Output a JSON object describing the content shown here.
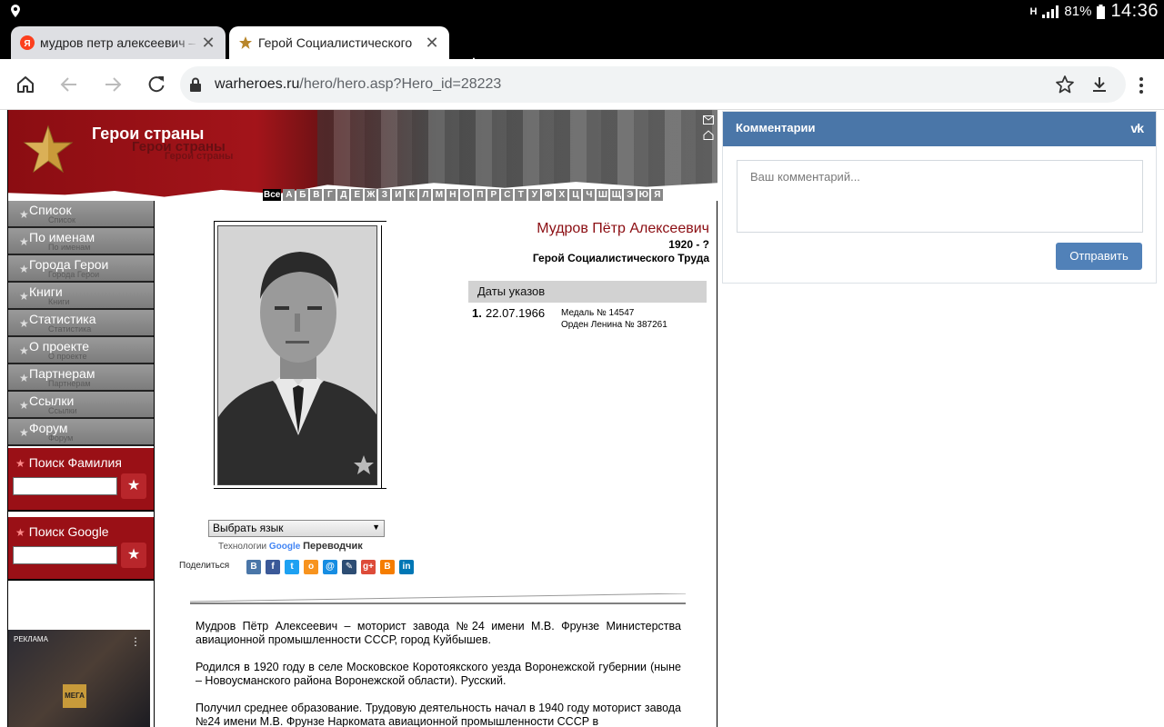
{
  "statusbar": {
    "network": "H",
    "battery": "81%",
    "time": "14:36"
  },
  "tabs": [
    {
      "title": "мудров петр алексеевич – ",
      "favicon": "yandex-icon",
      "active": false
    },
    {
      "title": "Герой Социалистического ",
      "favicon": "star-icon",
      "active": true
    }
  ],
  "toolbar": {
    "url_host": "warheroes.ru",
    "url_path": "/hero/hero.asp?Hero_id=28223"
  },
  "site": {
    "banner_title": "Герои страны",
    "banner_title_echo1": "Герои страны",
    "banner_title_echo2": "Герои страны",
    "alphabet": [
      "Все",
      "А",
      "Б",
      "В",
      "Г",
      "Д",
      "Е",
      "Ж",
      "З",
      "И",
      "К",
      "Л",
      "М",
      "Н",
      "О",
      "П",
      "Р",
      "С",
      "Т",
      "У",
      "Ф",
      "Х",
      "Ц",
      "Ч",
      "Ш",
      "Щ",
      "Э",
      "Ю",
      "Я"
    ],
    "nav": [
      {
        "label": "Список",
        "shadow": "Список"
      },
      {
        "label": "По именам",
        "shadow": "По именам"
      },
      {
        "label": "Города Герои",
        "shadow": "Города Герои"
      },
      {
        "label": "Книги",
        "shadow": "Книги"
      },
      {
        "label": "Статистика",
        "shadow": "Статистика"
      },
      {
        "label": "О проекте",
        "shadow": "О проекте"
      },
      {
        "label": "Партнерам",
        "shadow": "Партнерам"
      },
      {
        "label": "Ссылки",
        "shadow": "Ссылки"
      },
      {
        "label": "Форум",
        "shadow": "Форум"
      }
    ],
    "search_surname": "Поиск Фамилия",
    "search_google": "Поиск Google",
    "ad_label": "РЕКЛАМА",
    "ad_sign": "МЕГА"
  },
  "hero": {
    "name": "Мудров Пётр Алексеевич",
    "years": "1920 - ?",
    "title": "Герой Социалистического Труда",
    "decrees_header": "Даты указов",
    "decrees": [
      {
        "num": "1.",
        "date": "22.07.1966",
        "awards": [
          "Медаль № 14547",
          "Орден Ленина № 387261"
        ]
      }
    ]
  },
  "translate": {
    "select_label": "Выбрать язык",
    "powered_prefix": "Технологии",
    "google": "Google",
    "translator": "Переводчик"
  },
  "share": {
    "label": "Поделиться",
    "icons": [
      {
        "name": "vkontakte-icon",
        "glyph": "В",
        "color": "#4a76a8"
      },
      {
        "name": "facebook-icon",
        "glyph": "f",
        "color": "#3b5998"
      },
      {
        "name": "twitter-icon",
        "glyph": "t",
        "color": "#1da1f2"
      },
      {
        "name": "odnoklassniki-icon",
        "glyph": "о",
        "color": "#f7931e"
      },
      {
        "name": "mailru-icon",
        "glyph": "@",
        "color": "#168de2"
      },
      {
        "name": "livejournal-icon",
        "glyph": "✎",
        "color": "#2d4d73"
      },
      {
        "name": "googleplus-icon",
        "glyph": "g+",
        "color": "#dd4b39"
      },
      {
        "name": "blogger-icon",
        "glyph": "B",
        "color": "#f57d00"
      },
      {
        "name": "linkedin-icon",
        "glyph": "in",
        "color": "#0077b5"
      }
    ]
  },
  "bio": [
    "Мудров Пётр Алексеевич – моторист завода №24 имени М.В. Фрунзе Министерства авиационной промышленности СССР, город Куйбышев.",
    "Родился в 1920 году в селе Московское Коротоякского уезда Воронежской губернии (ныне – Новоусманского района Воронежской области). Русский.",
    "Получил среднее образование. Трудовую деятельность начал в 1940 году моторист завода №24 имени М.В. Фрунзе Наркомата авиационной промышленности СССР в"
  ],
  "vk": {
    "title": "Комментарии",
    "logo": "vk",
    "placeholder": "Ваш комментарий...",
    "send": "Отправить"
  }
}
